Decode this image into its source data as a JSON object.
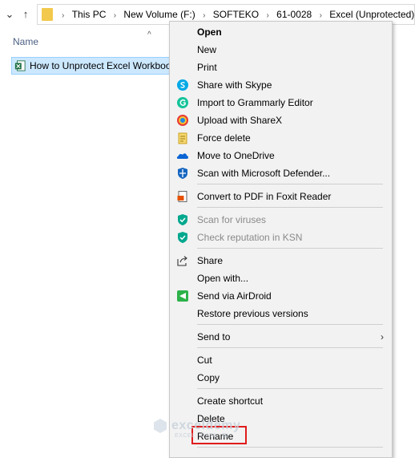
{
  "address_bar": {
    "back_glyph": "⌄",
    "up_glyph": "↑",
    "separator": "›",
    "crumbs": [
      "This PC",
      "New Volume (F:)",
      "SOFTEKO",
      "61-0028",
      "Excel (Unprotected)"
    ]
  },
  "file_list": {
    "column_name": "Name",
    "sort_glyph": "^",
    "selected_file": "How to Unprotect Excel Workbook without Password"
  },
  "context_menu": {
    "items": [
      {
        "label": "Open",
        "icon": "none",
        "bold": true
      },
      {
        "label": "New",
        "icon": "none"
      },
      {
        "label": "Print",
        "icon": "none"
      },
      {
        "label": "Share with Skype",
        "icon": "skype-icon"
      },
      {
        "label": "Import to Grammarly Editor",
        "icon": "grammarly-icon"
      },
      {
        "label": "Upload with ShareX",
        "icon": "sharex-icon"
      },
      {
        "label": "Force delete",
        "icon": "force-delete-icon"
      },
      {
        "label": "Move to OneDrive",
        "icon": "onedrive-icon"
      },
      {
        "label": "Scan with Microsoft Defender...",
        "icon": "defender-icon"
      },
      {
        "label": "Convert to PDF in Foxit Reader",
        "icon": "foxit-icon"
      },
      {
        "label": "Scan for viruses",
        "icon": "kaspersky-icon",
        "disabled": true
      },
      {
        "label": "Check reputation in KSN",
        "icon": "kaspersky-icon",
        "disabled": true
      },
      {
        "label": "Share",
        "icon": "share-icon"
      },
      {
        "label": "Open with...",
        "icon": "none"
      },
      {
        "label": "Send via AirDroid",
        "icon": "airdroid-icon"
      },
      {
        "label": "Restore previous versions",
        "icon": "none"
      },
      {
        "label": "Send to",
        "icon": "none",
        "submenu_glyph": "›"
      },
      {
        "label": "Cut",
        "icon": "none"
      },
      {
        "label": "Copy",
        "icon": "none"
      },
      {
        "label": "Create shortcut",
        "icon": "none"
      },
      {
        "label": "Delete",
        "icon": "none"
      },
      {
        "label": "Rename",
        "icon": "none",
        "highlighted": true
      }
    ]
  },
  "watermark": {
    "title": "exceldemy",
    "subtitle": "EXCEL · DATA · BI"
  },
  "colors": {
    "selection_bg": "#cce8ff",
    "menu_bg": "#f2f2f2",
    "highlight_box": "#e01b1b",
    "excel_green": "#1d6f42"
  }
}
